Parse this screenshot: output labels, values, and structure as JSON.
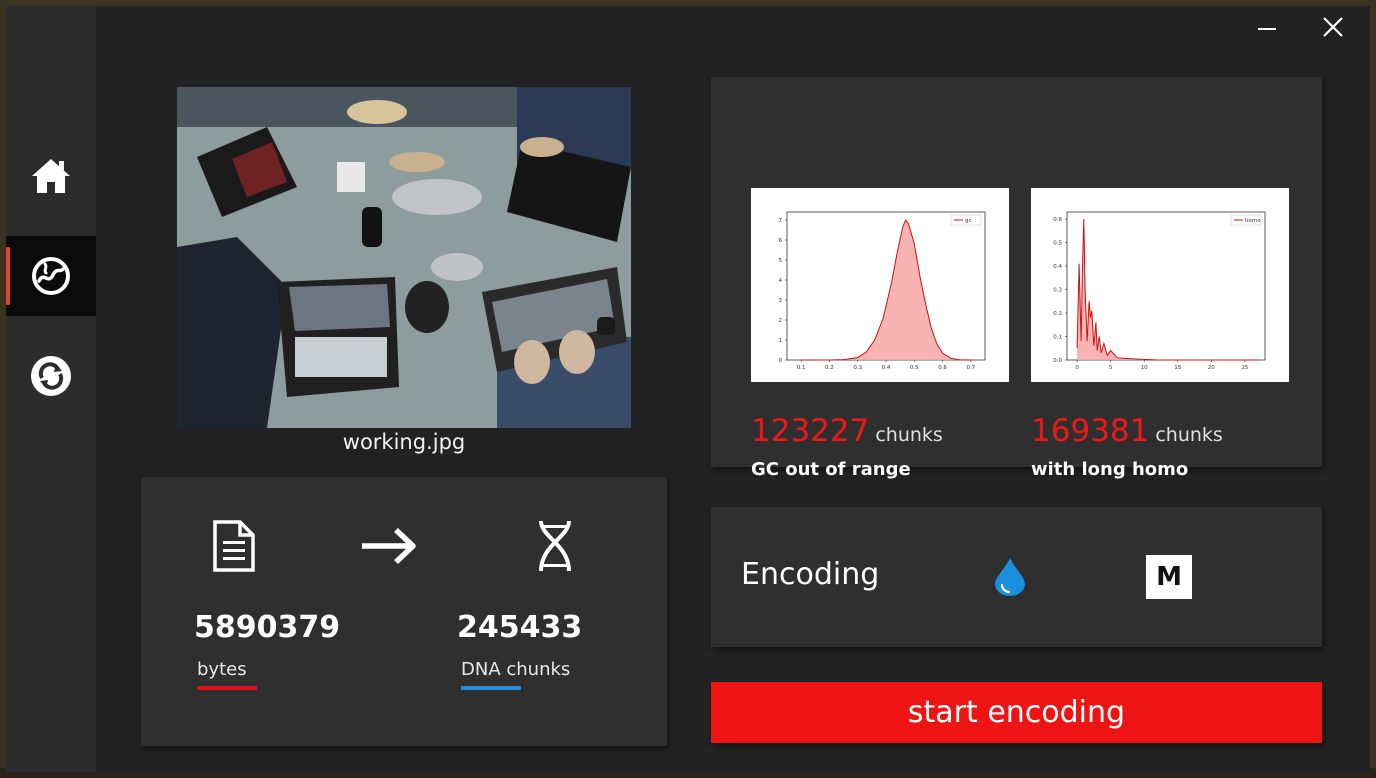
{
  "file": {
    "name": "working.jpg"
  },
  "conversion": {
    "bytes_value": "5890379",
    "bytes_label": "bytes",
    "chunks_value": "245433",
    "chunks_label": "DNA chunks",
    "colors": {
      "bytes_underline": "#e0101a",
      "chunks_underline": "#2a8ee0"
    }
  },
  "stats": {
    "gc": {
      "value": "123227",
      "unit": "chunks",
      "label": "GC out of range",
      "legend": "gc"
    },
    "homo": {
      "value": "169381",
      "unit": "chunks",
      "label": "with long homo",
      "legend": "homo"
    }
  },
  "encoding": {
    "label": "Encoding",
    "m_badge": "M"
  },
  "actions": {
    "start": "start encoding"
  },
  "sidebar": {
    "items": [
      {
        "icon": "home-icon"
      },
      {
        "icon": "globe-icon"
      },
      {
        "icon": "sync-icon"
      }
    ]
  },
  "colors": {
    "accent_red": "#ee1414",
    "accent_blue": "#1a8fde"
  },
  "chart_data": [
    {
      "type": "area",
      "series": [
        {
          "name": "gc",
          "x": [
            0.1,
            0.2,
            0.25,
            0.3,
            0.33,
            0.36,
            0.39,
            0.42,
            0.44,
            0.46,
            0.47,
            0.48,
            0.5,
            0.52,
            0.54,
            0.56,
            0.58,
            0.6,
            0.63,
            0.66,
            0.7
          ],
          "values": [
            0,
            0,
            0.02,
            0.12,
            0.4,
            1.0,
            2.1,
            3.9,
            5.4,
            6.7,
            7.0,
            6.8,
            5.8,
            4.2,
            2.8,
            1.6,
            0.8,
            0.35,
            0.08,
            0.01,
            0
          ]
        }
      ],
      "xticks": [
        "0.1",
        "0.2",
        "0.3",
        "0.4",
        "0.5",
        "0.6",
        "0.7"
      ],
      "yticks": [
        "0",
        "1",
        "2",
        "3",
        "4",
        "5",
        "6",
        "7"
      ],
      "xlim": [
        0.05,
        0.75
      ],
      "ylim": [
        0,
        7.4
      ]
    },
    {
      "type": "area",
      "series": [
        {
          "name": "homo",
          "x": [
            0,
            0.3,
            0.6,
            0.8,
            1.0,
            1.2,
            1.5,
            1.8,
            2.0,
            2.2,
            2.5,
            2.8,
            3.0,
            3.3,
            3.6,
            4.0,
            4.5,
            5.0,
            6.0,
            8.0,
            12,
            20,
            27
          ],
          "values": [
            0.05,
            0.41,
            0.08,
            0.38,
            0.6,
            0.3,
            0.08,
            0.25,
            0.18,
            0.21,
            0.06,
            0.16,
            0.04,
            0.1,
            0.03,
            0.07,
            0.02,
            0.04,
            0.01,
            0.005,
            0,
            0,
            0
          ]
        }
      ],
      "xticks": [
        "0",
        "5",
        "10",
        "15",
        "20",
        "25"
      ],
      "yticks": [
        "0.0",
        "0.1",
        "0.2",
        "0.3",
        "0.4",
        "0.5",
        "0.6"
      ],
      "xlim": [
        -1.5,
        28
      ],
      "ylim": [
        0,
        0.63
      ]
    }
  ]
}
